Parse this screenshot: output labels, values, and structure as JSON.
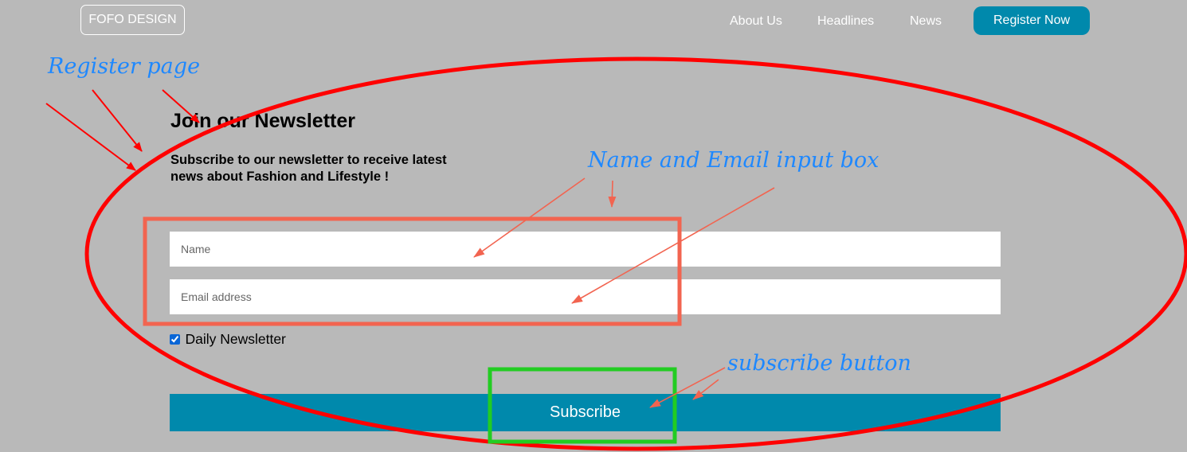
{
  "header": {
    "logo": "FOFO DESIGN",
    "nav": [
      "About Us",
      "Headlines",
      "News"
    ],
    "register_label": "Register Now"
  },
  "newsletter": {
    "title": "Join our Newsletter",
    "subtitle": "Subscribe to our newsletter to receive latest news about Fashion and Lifestyle !",
    "name_placeholder": "Name",
    "email_placeholder": "Email address",
    "checkbox_label": "Daily Newsletter",
    "checkbox_checked": true,
    "subscribe_label": "Subscribe"
  },
  "annotations": {
    "register_page": "Register page",
    "inputs": "Name and Email input box",
    "subscribe": "subscribe button"
  },
  "colors": {
    "background": "#b9b9b9",
    "accent": "#0089ac",
    "annotation_text": "#1e88ff",
    "ellipse": "#ff0000",
    "input_box_highlight": "#f26450",
    "button_highlight": "#22cc22"
  }
}
